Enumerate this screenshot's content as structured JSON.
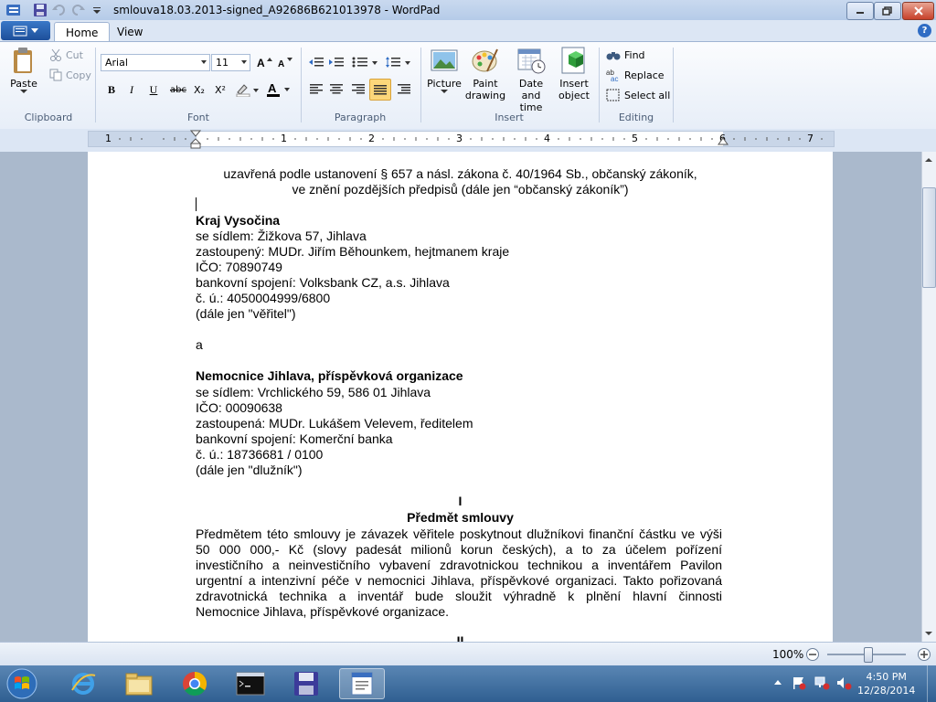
{
  "window": {
    "title": "smlouva18.03.2013-signed_A92686B621013978 - WordPad"
  },
  "tabs": [
    {
      "label": "Home"
    },
    {
      "label": "View"
    }
  ],
  "help_label": "?",
  "clipboard": {
    "paste": "Paste",
    "cut": "Cut",
    "copy": "Copy",
    "group": "Clipboard"
  },
  "font": {
    "family": "Arial",
    "size": "11",
    "group": "Font",
    "bold": "B",
    "italic": "I",
    "underline": "U",
    "strike": "abc",
    "subscript": "X₂",
    "superscript": "X²"
  },
  "paragraph": {
    "group": "Paragraph"
  },
  "insert": {
    "picture": "Picture",
    "paint_1": "Paint",
    "paint_2": "drawing",
    "datetime_1": "Date and",
    "datetime_2": "time",
    "object_1": "Insert",
    "object_2": "object",
    "group": "Insert"
  },
  "editing": {
    "find": "Find",
    "replace": "Replace",
    "select_all": "Select all",
    "group": "Editing"
  },
  "ruler": {
    "numbers": [
      "1",
      "1",
      "2",
      "3",
      "4",
      "5",
      "6",
      "7"
    ]
  },
  "document": {
    "intro": [
      "uzavřená podle ustanovení § 657 a násl. zákona č. 40/1964 Sb., občanský zákoník,",
      "ve znění pozdějších předpisů (dále jen “občanský zákoník”)"
    ],
    "party1": {
      "name": "Kraj Vysočina",
      "lines": [
        "se sídlem: Žižkova 57, Jihlava",
        "zastoupený: MUDr. Jiřím Běhounkem, hejtmanem kraje",
        "IČO: 70890749",
        "bankovní spojení: Volksbank CZ, a.s. Jihlava",
        "č. ú.: 4050004999/6800",
        "(dále jen \"věřitel\")"
      ]
    },
    "and": "a",
    "party2": {
      "name": "Nemocnice Jihlava, příspěvková organizace",
      "lines": [
        "se sídlem: Vrchlického 59, 586 01 Jihlava",
        "IČO: 00090638",
        "zastoupená: MUDr. Lukášem Velevem, ředitelem",
        "bankovní spojení: Komerční banka",
        "č. ú.: 18736681 / 0100",
        "(dále jen \"dlužník\")"
      ]
    },
    "section1": {
      "number": "I",
      "title": "Předmět smlouvy",
      "para_lines": [
        "Předmětem této smlouvy je závazek věřitele poskytnout dlužníkovi finanční částku ve výši",
        "50 000 000,- Kč (slovy padesát milionů korun českých), a to za účelem pořízení",
        "investičního a neinvestičního vybavení zdravotnickou technikou a inventářem Pavilon",
        "urgentní a intenzivní péče v nemocnici Jihlava, příspěvkové organizaci. Takto pořizovaná",
        "zdravotnická technika a inventář bude sloužit výhradně k plnění hlavní činnosti",
        "Nemocnice Jihlava, příspěvkové organizace."
      ]
    },
    "section2_number": "II"
  },
  "status": {
    "zoom": "100%"
  },
  "clock": {
    "time": "4:50 PM",
    "date": "12/28/2014"
  }
}
